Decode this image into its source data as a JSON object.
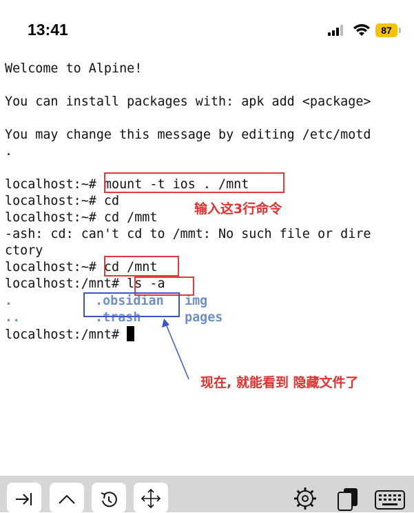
{
  "status_bar": {
    "time": "13:41",
    "battery": "87"
  },
  "terminal": {
    "lines": {
      "welcome": "Welcome to Alpine!",
      "install": "You can install packages with: apk add <package>",
      "motd": "You may change this message by editing /etc/motd",
      "dot": ".",
      "cmd_mount": "localhost:~# mount -t ios . /mnt",
      "cmd_cd": "localhost:~# cd",
      "cmd_cd_mmt": "localhost:~# cd /mmt",
      "error1": "-ash: cd: can't cd to /mmt: No such file or dire",
      "error2": "ctory",
      "cmd_cd_mnt": "localhost:~# cd /mnt",
      "cmd_ls": "localhost:/mnt# ls -a",
      "prompt": "localhost:/mnt# "
    },
    "listing": {
      "row1": [
        ".",
        ".obsidian",
        "img"
      ],
      "row2": [
        "..",
        ".trash",
        "pages"
      ]
    }
  },
  "annotations": {
    "enter_commands": "输入这3行命令",
    "now_visible": "现在, 就能看到 隐藏文件了"
  },
  "toolbar": {
    "icons": [
      "tab-icon",
      "chevron-up-icon",
      "history-icon",
      "move-arrows-icon",
      "settings-gear-icon",
      "windows-icon",
      "keyboard-icon"
    ]
  },
  "colors": {
    "annotation_red": "#e53030",
    "listing_blue": "#6e8fc8",
    "toolbar_bg": "#d6d6d9",
    "battery": "#f4c20d"
  }
}
